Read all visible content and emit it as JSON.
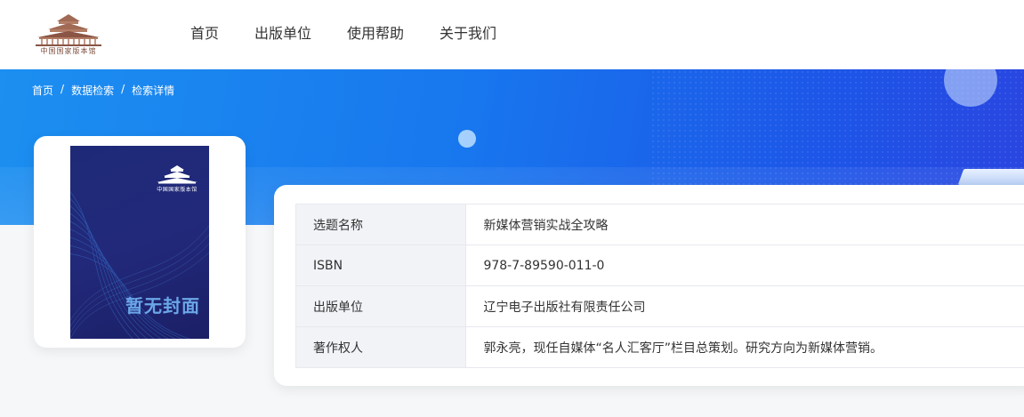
{
  "header": {
    "logo_text": "中国国家版本馆",
    "nav": [
      "首页",
      "出版单位",
      "使用帮助",
      "关于我们"
    ]
  },
  "breadcrumb": [
    "首页",
    "数据检索",
    "检索详情"
  ],
  "cover": {
    "logo_text": "中国国家版本馆",
    "placeholder_text": "暂无封面"
  },
  "details": {
    "rows": [
      {
        "label": "选题名称",
        "value": "新媒体营销实战全攻略"
      },
      {
        "label": "ISBN",
        "value": "978-7-89590-011-0"
      },
      {
        "label": "出版单位",
        "value": "辽宁电子出版社有限责任公司"
      },
      {
        "label": "著作权人",
        "value": "郭永亮，现任自媒体“名人汇客厅”栏目总策划。研究方向为新媒体营销。"
      }
    ]
  },
  "colors": {
    "banner_start": "#1c8ff0",
    "banner_end": "#2a45e0",
    "cover_bg": "#1e2a78",
    "cover_text": "#6aa6e8"
  }
}
